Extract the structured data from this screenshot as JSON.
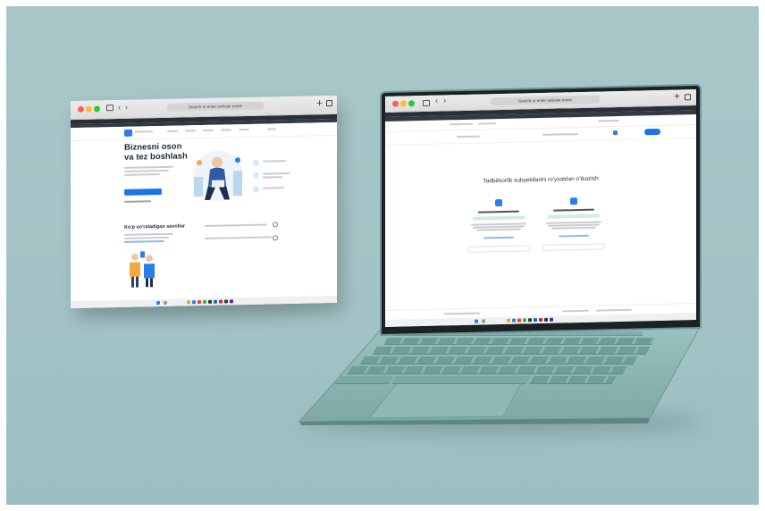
{
  "left_window": {
    "address": "Search or enter website name",
    "hero_title_line1": "Biznesni oson",
    "hero_title_line2": "va tez boshlash",
    "faq_title": "Ko'p so'raladigan savollar"
  },
  "laptop_window": {
    "address": "Search or enter website name",
    "page_heading": "Tadbirkorlik subyektlarini ro'yxatdan o'tkazish"
  },
  "colors": {
    "background": "#a6c5c7",
    "accent_blue": "#1a73e8",
    "laptop_body": "#7aa6a3",
    "traffic_red": "#ff5f57",
    "traffic_yellow": "#febc2e",
    "traffic_green": "#28c840"
  },
  "icons": [
    "sidebar-toggle-icon",
    "back-arrow-icon",
    "forward-arrow-icon",
    "plus-icon",
    "tabs-icon",
    "logo-icon"
  ]
}
